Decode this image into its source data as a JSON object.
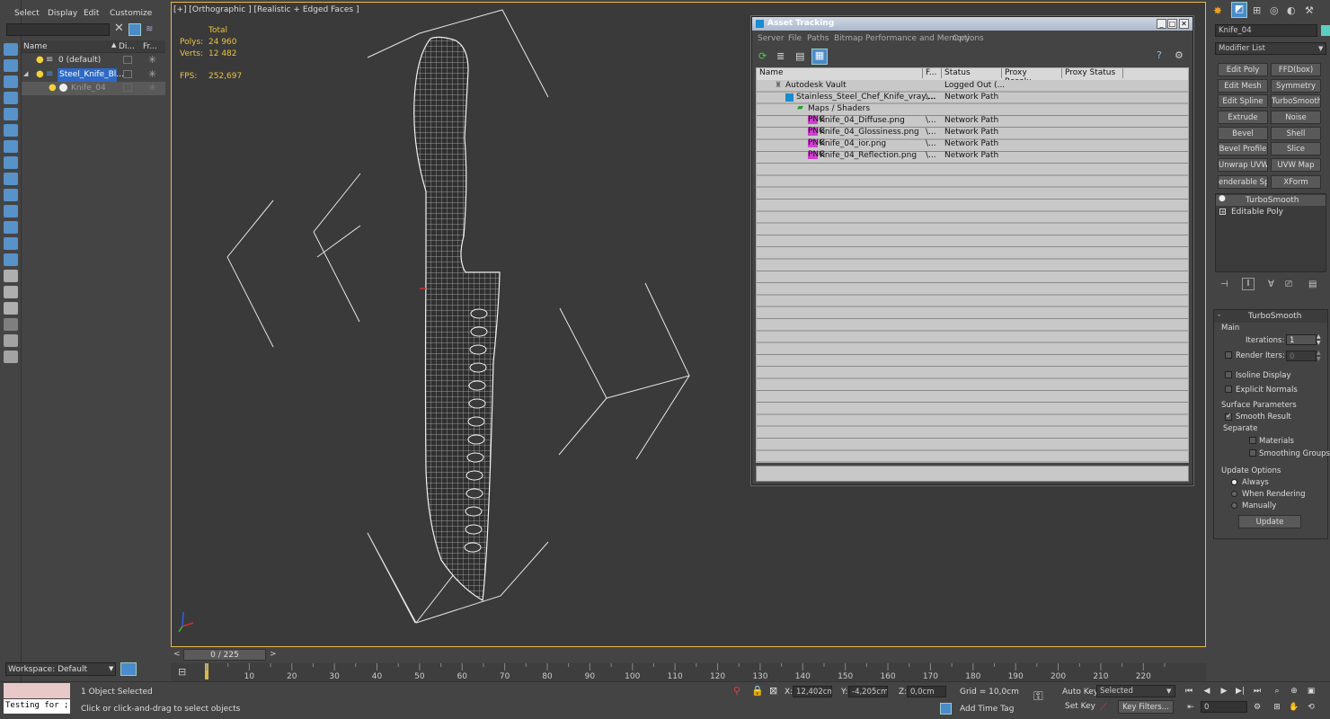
{
  "left_toolbar_icons": [
    "select-icon",
    "lock-icon",
    "filter-icon",
    "display-icon",
    "layers-icon",
    "camera-icon",
    "light-icon",
    "helper-icon",
    "shape-icon",
    "geometry-icon",
    "space-warp-icon",
    "group-icon",
    "bone-icon",
    "xref-icon",
    "particle-icon",
    "frozen-icon",
    "hidden-icon",
    "funnel-icon",
    "hierarchy-icon",
    "sync-icon"
  ],
  "scene_explorer": {
    "menu": [
      "Select",
      "Display",
      "Edit",
      "Customize"
    ],
    "search_placeholder": "",
    "columns": {
      "name": "Name",
      "display": "Di...",
      "freeze": "Fr..."
    },
    "rows": [
      {
        "label": "0 (default)",
        "level": 0
      },
      {
        "label": "Steel_Knife_Bl...",
        "level": 0,
        "selected": true
      },
      {
        "label": "Knife_04",
        "level": 1
      }
    ],
    "workspace": "Workspace: Default"
  },
  "viewport": {
    "label": "[+] [Orthographic ] [Realistic + Edged Faces ]",
    "stats_total": "Total",
    "polys_label": "Polys:",
    "polys_value": "24 960",
    "verts_label": "Verts:",
    "verts_value": "12 482",
    "fps_label": "FPS:",
    "fps_value": "252,697"
  },
  "asset_tracking": {
    "title": "Asset Tracking",
    "menu": [
      "Server",
      "File",
      "Paths",
      "Bitmap Performance and Memory",
      "Options"
    ],
    "columns": [
      "Name",
      "F...",
      "Status",
      "Proxy Resolu...",
      "Proxy Status"
    ],
    "rows": [
      {
        "name": "Autodesk Vault",
        "f": "",
        "status": "Logged Out (...",
        "icon": "vault"
      },
      {
        "name": "Stainless_Steel_Chef_Knife_vray....",
        "f": "\\...",
        "status": "Network Path",
        "icon": "max"
      },
      {
        "name": "Maps / Shaders",
        "f": "",
        "status": "",
        "icon": "maps"
      },
      {
        "name": "Knife_04_Diffuse.png",
        "f": "\\...",
        "status": "Network Path",
        "icon": "png"
      },
      {
        "name": "Knife_04_Glossiness.png",
        "f": "\\...",
        "status": "Network Path",
        "icon": "png"
      },
      {
        "name": "Knife_04_ior.png",
        "f": "\\...",
        "status": "Network Path",
        "icon": "png"
      },
      {
        "name": "Knife_04_Reflection.png",
        "f": "\\...",
        "status": "Network Path",
        "icon": "png"
      }
    ],
    "png_badge": "PNG"
  },
  "command_panel": {
    "object_name": "Knife_04",
    "modifier_list": "Modifier List",
    "buttons": [
      "Edit Poly",
      "FFD(box)",
      "Edit Mesh",
      "Symmetry",
      "Edit Spline",
      "TurboSmooth",
      "Extrude",
      "Noise",
      "Bevel",
      "Shell",
      "Bevel Profile",
      "Slice",
      "Unwrap UVW",
      "UVW Map",
      "enderable Splin",
      "XForm"
    ],
    "stack": [
      "TurboSmooth",
      "Editable Poly"
    ],
    "rollout_title": "TurboSmooth",
    "main_label": "Main",
    "iterations_label": "Iterations:",
    "iterations_value": "1",
    "render_iters_label": "Render Iters:",
    "render_iters_value": "0",
    "isoline_label": "Isoline Display",
    "explicit_normals_label": "Explicit Normals",
    "surface_params_label": "Surface Parameters",
    "smooth_result_label": "Smooth Result",
    "separate_label": "Separate",
    "materials_label": "Materials",
    "smoothing_groups_label": "Smoothing Groups",
    "update_options_label": "Update Options",
    "always_label": "Always",
    "when_rendering_label": "When Rendering",
    "manually_label": "Manually",
    "update_button": "Update"
  },
  "timeline": {
    "frame_counter": "0 / 225",
    "ticks": [
      "10",
      "20",
      "30",
      "40",
      "50",
      "60",
      "70",
      "80",
      "90",
      "100",
      "110",
      "120",
      "130",
      "140",
      "150",
      "160",
      "170",
      "180",
      "190",
      "200",
      "210",
      "220"
    ]
  },
  "status_bar": {
    "maxscript_text": "Testing for ;",
    "selection_status": "1 Object Selected",
    "prompt": "Click or click-and-drag to select objects",
    "x_label": "X:",
    "x_value": "12,402cm",
    "y_label": "Y:",
    "y_value": "-4,205cm",
    "z_label": "Z:",
    "z_value": "0,0cm",
    "grid": "Grid = 10,0cm",
    "add_time_tag": "Add Time Tag",
    "auto_key": "Auto Key",
    "set_key": "Set Key",
    "selected_dropdown": "Selected",
    "key_filters": "Key Filters...",
    "current_frame": "0"
  }
}
